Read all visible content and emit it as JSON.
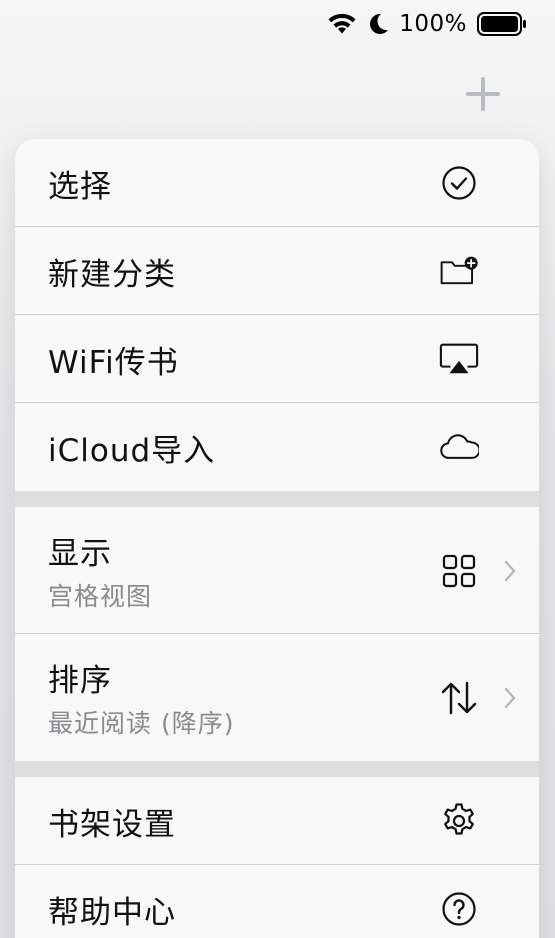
{
  "status_bar": {
    "battery_percent": "100%",
    "icons": [
      "wifi-icon",
      "moon-icon",
      "battery-icon"
    ]
  },
  "header": {
    "add_icon": "plus-icon"
  },
  "menu": {
    "group1": [
      {
        "label": "选择",
        "icon": "checkmark-circle-icon"
      },
      {
        "label": "新建分类",
        "icon": "folder-add-icon"
      },
      {
        "label": "WiFi传书",
        "icon": "airplay-icon"
      },
      {
        "label": "iCloud导入",
        "icon": "cloud-icon"
      }
    ],
    "group2": [
      {
        "label": "显示",
        "sublabel": "宫格视图",
        "icon": "grid-icon"
      },
      {
        "label": "排序",
        "sublabel": "最近阅读 (降序)",
        "icon": "sort-arrows-icon"
      }
    ],
    "group3": [
      {
        "label": "书架设置",
        "icon": "gear-icon"
      },
      {
        "label": "帮助中心",
        "icon": "help-circle-icon"
      }
    ]
  },
  "colors": {
    "background": "#f1f1f2",
    "menu_bg": "#f8f8f9",
    "separator": "#cfcfd3",
    "group_gap": "#dedee1",
    "sublabel": "#8a8a8e",
    "add_icon": "#b8bcc2"
  }
}
